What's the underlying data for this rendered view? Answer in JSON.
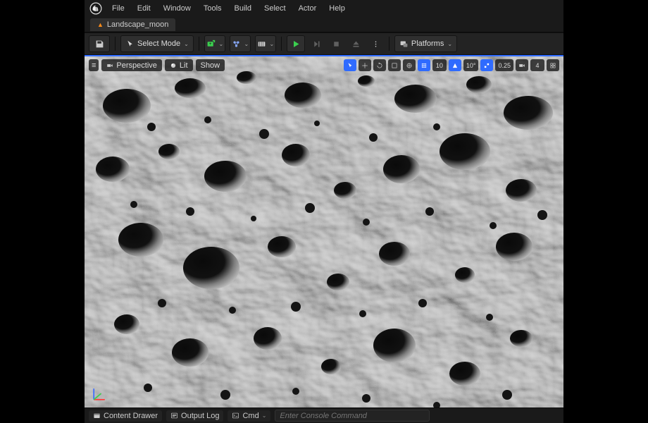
{
  "menu": {
    "file": "File",
    "edit": "Edit",
    "window": "Window",
    "tools": "Tools",
    "build": "Build",
    "select": "Select",
    "actor": "Actor",
    "help": "Help"
  },
  "tab": {
    "name": "Landscape_moon"
  },
  "toolbar": {
    "selectMode": "Select Mode",
    "chevron": "⌄",
    "platforms": "Platforms"
  },
  "viewport": {
    "menu": "≡",
    "perspective": "Perspective",
    "lit": "Lit",
    "show": "Show",
    "gridSnap": "10",
    "rotSnap": "10°",
    "scaleSnap": "0.25",
    "camSpeed": "4"
  },
  "bottom": {
    "contentDrawer": "Content Drawer",
    "outputLog": "Output Log",
    "cmdLabel": "Cmd",
    "cmdPlaceholder": "Enter Console Command"
  }
}
